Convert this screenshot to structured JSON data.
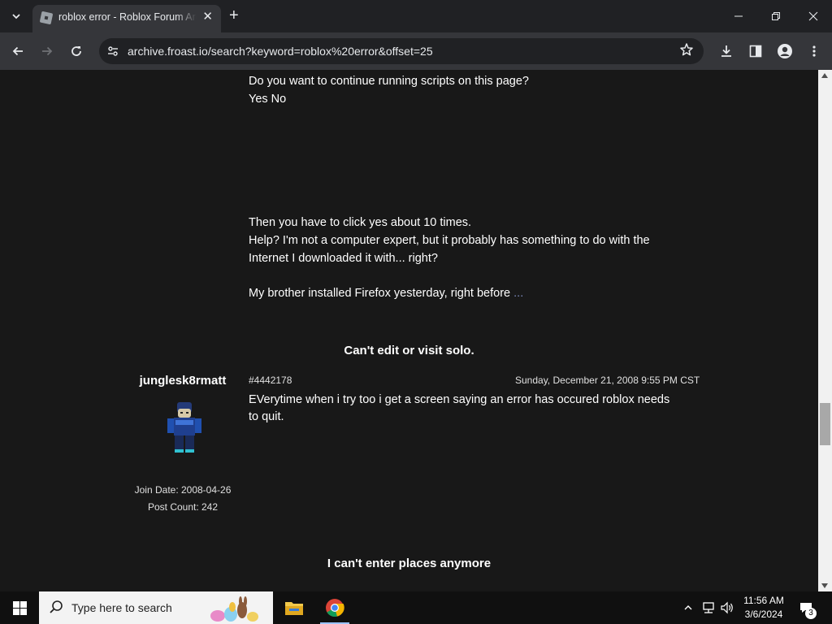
{
  "browser": {
    "tab_title": "roblox error - Roblox Forum Archive",
    "url": "archive.froast.io/search?keyword=roblox%20error&offset=25"
  },
  "content": {
    "prev_post": {
      "lines": [
        "Do you want to continue running scripts on this page?",
        "Yes No",
        "Then you have to click yes about 10 times.",
        "Help? I'm not a computer expert, but it probably has something to do with the",
        "Internet I downloaded it with... right?",
        "My brother installed Firefox yesterday, right before"
      ],
      "ellipsis": "..."
    },
    "thread1": {
      "title": "Can't edit or visit solo.",
      "author": "junglesk8rmatt",
      "post_id": "#4442178",
      "date": "Sunday, December 21, 2008 9:55 PM CST",
      "body_lines": [
        "EVerytime when i try too i get a screen saying an error has occured roblox needs",
        "to quit."
      ],
      "join_date": "Join Date: 2008-04-26",
      "post_count": "Post Count: 242"
    },
    "thread2": {
      "title": "I can't enter places anymore"
    }
  },
  "taskbar": {
    "search_placeholder": "Type here to search",
    "time": "11:56 AM",
    "date": "3/6/2024",
    "notification_count": "3"
  }
}
